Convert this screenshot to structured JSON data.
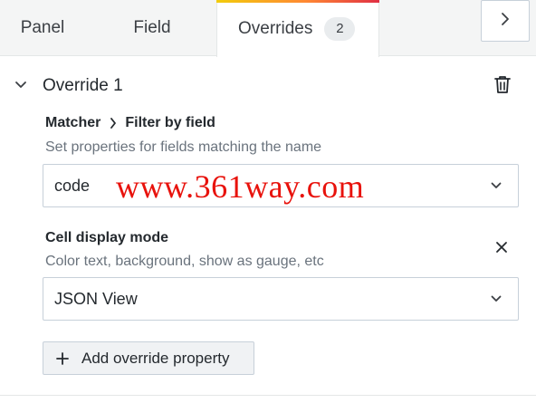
{
  "tabs": {
    "panel": "Panel",
    "field": "Field",
    "overrides": "Overrides",
    "overrides_count": "2"
  },
  "override": {
    "title": "Override 1",
    "matcher_label": "Matcher",
    "matcher_value": "Filter by field",
    "matcher_description": "Set properties for fields matching the name",
    "field_select_value": "code",
    "property_title": "Cell display mode",
    "property_description": "Color text, background, show as gauge, etc",
    "property_select_value": "JSON View",
    "add_button_label": "Add override property"
  },
  "watermark": "www.361way.com",
  "icons": {
    "next": "chevron-right-icon",
    "collapse": "chevron-down-icon",
    "delete": "trash-icon",
    "remove": "close-icon",
    "add": "plus-icon"
  },
  "colors": {
    "accent_gradient": [
      "#f2cc0c",
      "#ff8833",
      "#e02f44"
    ],
    "watermark": "#e8120c"
  }
}
